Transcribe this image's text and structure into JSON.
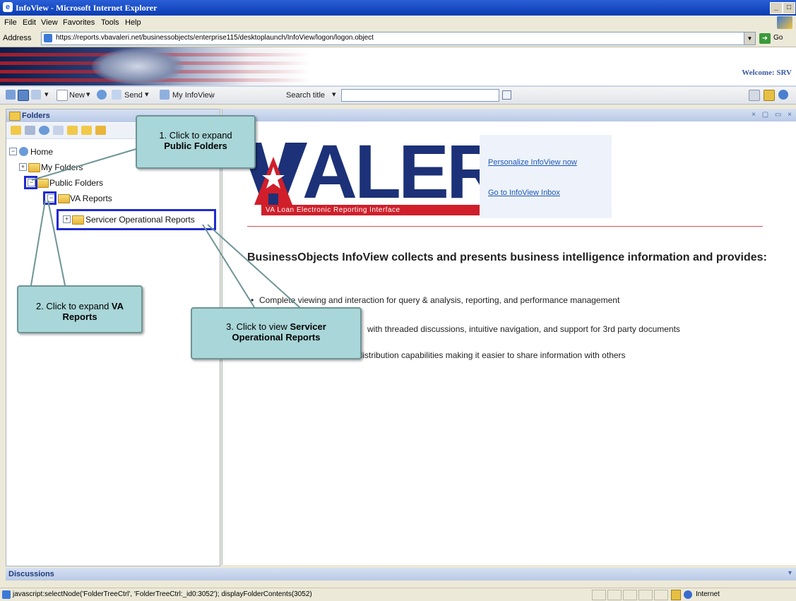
{
  "window": {
    "title": "InfoView - Microsoft Internet Explorer",
    "buttons": [
      "_",
      "□",
      "×"
    ]
  },
  "menu": [
    "File",
    "Edit",
    "View",
    "Favorites",
    "Tools",
    "Help"
  ],
  "address": {
    "label": "Address",
    "url": "https://reports.vbavaleri.net/businessobjects/enterprise115/desktoplaunch/InfoView/logon/logon.object",
    "go_label": "Go"
  },
  "banner": {
    "welcome": "Welcome: SRV"
  },
  "toolbar": {
    "new_label": "New",
    "send_label": "Send",
    "my_infoview_label": "My InfoView",
    "search_label": "Search title",
    "search_value": ""
  },
  "folders": {
    "title": "Folders",
    "tree": {
      "home": "Home",
      "my_folders": "My Folders",
      "public_folders": "Public Folders",
      "va_reports": "VA Reports",
      "servicer_reports": "Servicer Operational Reports"
    }
  },
  "main": {
    "logo_text": "ALERI",
    "logo_tagline": "VA Loan Electronic Reporting Interface",
    "links": {
      "personalize": "Personalize InfoView now",
      "inbox": "Go to InfoView Inbox"
    },
    "heading": "BusinessObjects InfoView collects and presents business intelligence information and provides:",
    "bullets": [
      "Complete viewing and interaction for query & analysis, reporting, and performance management",
      "with threaded discussions, intuitive navigation, and support for 3rd party documents",
      "nd distribution capabilities making it easier to share information with others"
    ]
  },
  "callouts": {
    "c1_line1": "1. Click to expand",
    "c1_line2": "Public Folders",
    "c2_line1": "2. Click to expand ",
    "c2_bold1": "VA",
    "c2_bold2": "Reports",
    "c3_line1": "3. Click to view ",
    "c3_bold1": "Servicer",
    "c3_bold2": "Operational Reports"
  },
  "discussions": {
    "title": "Discussions"
  },
  "status": {
    "text": "javascript:selectNode('FolderTreeCtrl', 'FolderTreeCtrl:_id0:3052'); displayFolderContents(3052)",
    "zone": "Internet"
  },
  "colors": {
    "highlight_box": "#1f2bd0",
    "callout_bg": "#a9d6d8",
    "logo_red": "#d01f2a",
    "logo_blue": "#1c3178",
    "link_blue": "#1b58b8"
  }
}
